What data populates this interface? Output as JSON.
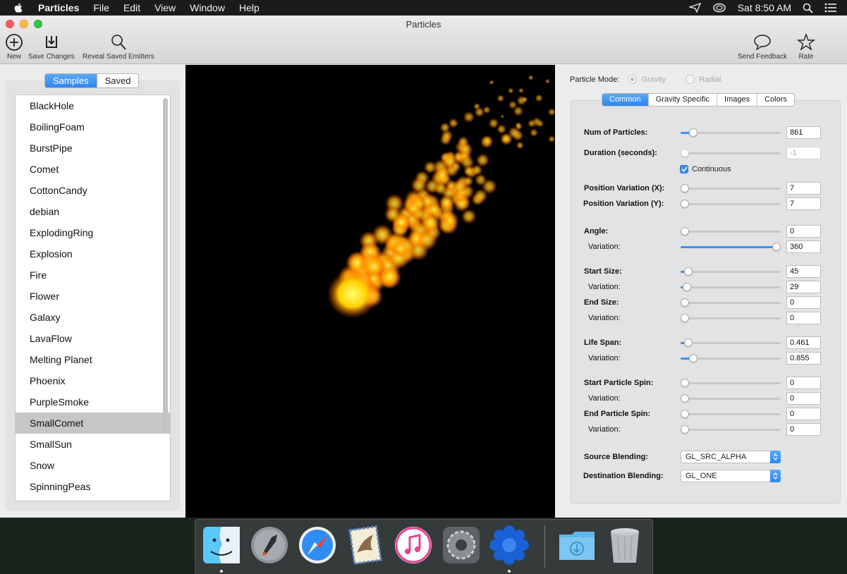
{
  "menubar": {
    "app_name": "Particles",
    "items": [
      "File",
      "Edit",
      "View",
      "Window",
      "Help"
    ],
    "clock": "Sat 8:50 AM"
  },
  "window": {
    "title": "Particles",
    "toolbar": {
      "new": "New",
      "save": "Save Changes",
      "reveal": "Reveal Saved Emitters",
      "feedback": "Send Feedback",
      "rate": "Rate"
    }
  },
  "sidebar": {
    "segments": [
      "Samples",
      "Saved"
    ],
    "active_segment": "Samples",
    "items": [
      "BlackHole",
      "BoilingFoam",
      "BurstPipe",
      "Comet",
      "CottonCandy",
      "debian",
      "ExplodingRing",
      "Explosion",
      "Fire",
      "Flower",
      "Galaxy",
      "LavaFlow",
      "Melting Planet",
      "Phoenix",
      "PurpleSmoke",
      "SmallComet",
      "SmallSun",
      "Snow",
      "SpinningPeas"
    ],
    "selected": "SmallComet"
  },
  "panel": {
    "mode_label": "Particle Mode:",
    "mode_gravity": "Gravity",
    "mode_radial": "Radial",
    "tabs": [
      "Common",
      "Gravity Specific",
      "Images",
      "Colors"
    ],
    "active_tab": "Common",
    "continuous_label": "Continuous",
    "continuous_checked": true,
    "rows": [
      {
        "label": "Num of Particles:",
        "value": "861",
        "level": 0.13,
        "bold": true
      },
      {
        "label": "Duration (seconds):",
        "value": "-1",
        "level": 0.0,
        "bold": true,
        "disabled": true
      },
      {
        "label": "Position Variation (X):",
        "value": "7",
        "level": 0.04,
        "bold": true
      },
      {
        "label": "Position Variation (Y):",
        "value": "7",
        "level": 0.04,
        "bold": true
      },
      {
        "label": "Angle:",
        "value": "0",
        "level": 0.04,
        "bold": true
      },
      {
        "label": "Variation:",
        "value": "360",
        "level": 0.96,
        "bold": false
      },
      {
        "label": "Start Size:",
        "value": "45",
        "level": 0.08,
        "bold": true
      },
      {
        "label": "Variation:",
        "value": "29",
        "level": 0.06,
        "bold": false
      },
      {
        "label": "End Size:",
        "value": "0",
        "level": 0.04,
        "bold": true
      },
      {
        "label": "Variation:",
        "value": "0",
        "level": 0.04,
        "bold": false
      },
      {
        "label": "Life Span:",
        "value": "0.461",
        "level": 0.08,
        "bold": true
      },
      {
        "label": "Variation:",
        "value": "0.855",
        "level": 0.13,
        "bold": false
      },
      {
        "label": "Start Particle Spin:",
        "value": "0",
        "level": 0.04,
        "bold": true
      },
      {
        "label": "Variation:",
        "value": "0",
        "level": 0.04,
        "bold": false
      },
      {
        "label": "End Particle Spin:",
        "value": "0",
        "level": 0.04,
        "bold": true
      },
      {
        "label": "Variation:",
        "value": "0",
        "level": 0.04,
        "bold": false
      }
    ],
    "source_blending_label": "Source Blending:",
    "source_blending": "GL_SRC_ALPHA",
    "dest_blending_label": "Destination Blending:",
    "dest_blending": "GL_ONE"
  },
  "dock": {
    "apps": [
      "finder-icon",
      "launchpad-icon",
      "safari-icon",
      "mail-icon",
      "itunes-icon",
      "system-preferences-icon",
      "particles-icon",
      "downloads-icon",
      "trash-icon"
    ]
  }
}
